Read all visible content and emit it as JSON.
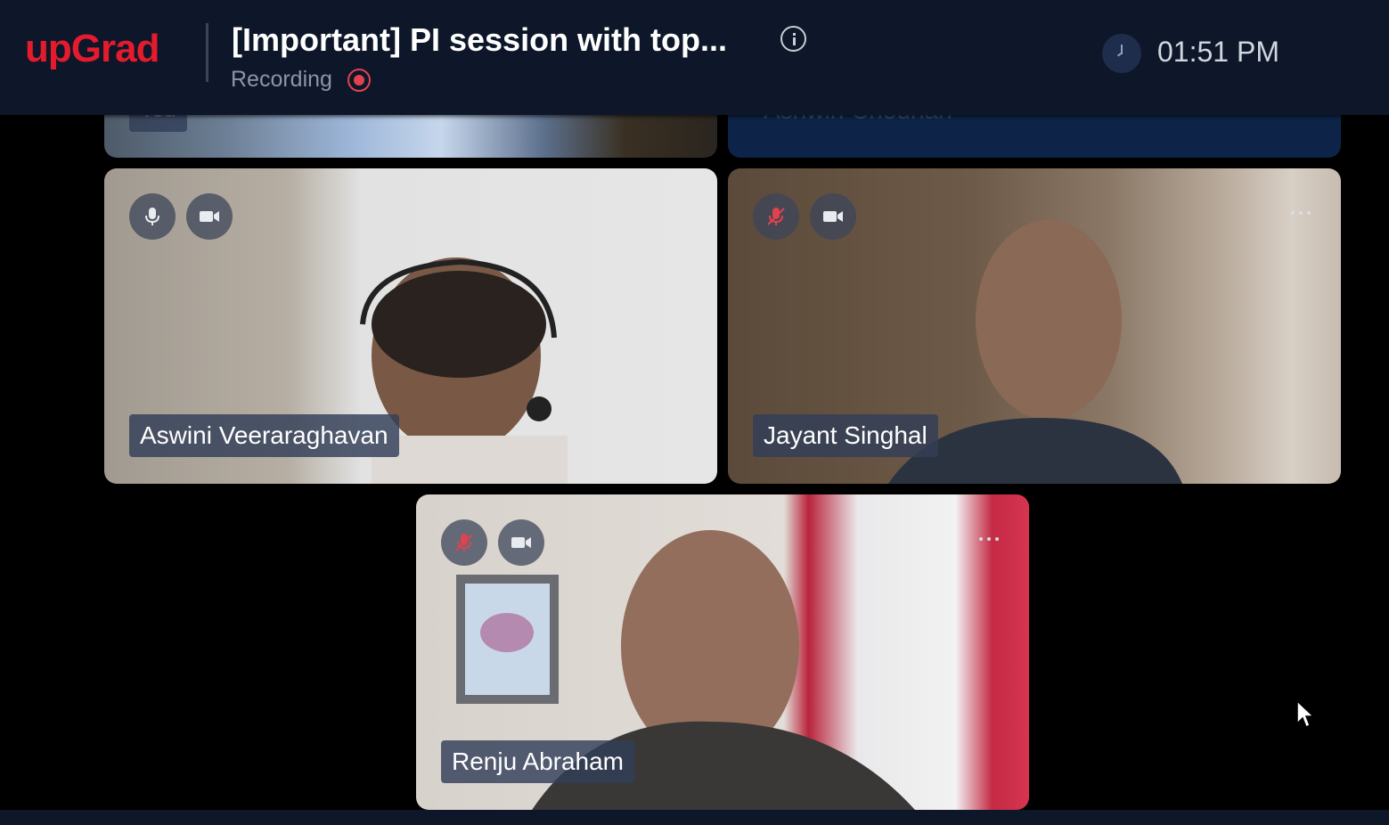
{
  "header": {
    "logo": "upGrad",
    "title": "[Important] PI session with top...",
    "recording_label": "Recording",
    "time": "01:51 PM"
  },
  "participants": [
    {
      "name": "You"
    },
    {
      "name": "Ashwin Chouhan"
    },
    {
      "name": "Aswini Veeraraghavan",
      "mic": "on",
      "camera": "on"
    },
    {
      "name": "Jayant Singhal",
      "mic": "muted",
      "camera": "on"
    },
    {
      "name": "Renju Abraham",
      "mic": "muted",
      "camera": "on"
    }
  ],
  "icons": {
    "info": "info-icon",
    "recording": "recording-icon",
    "clock": "clock-icon",
    "mic": "microphone-icon",
    "mic_muted": "microphone-muted-icon",
    "camera": "camera-icon",
    "more": "more-options-icon"
  },
  "colors": {
    "brand": "#e31b2d",
    "header_bg": "#0d1729",
    "recording": "#e0424e",
    "muted_mic": "#e0424e"
  }
}
